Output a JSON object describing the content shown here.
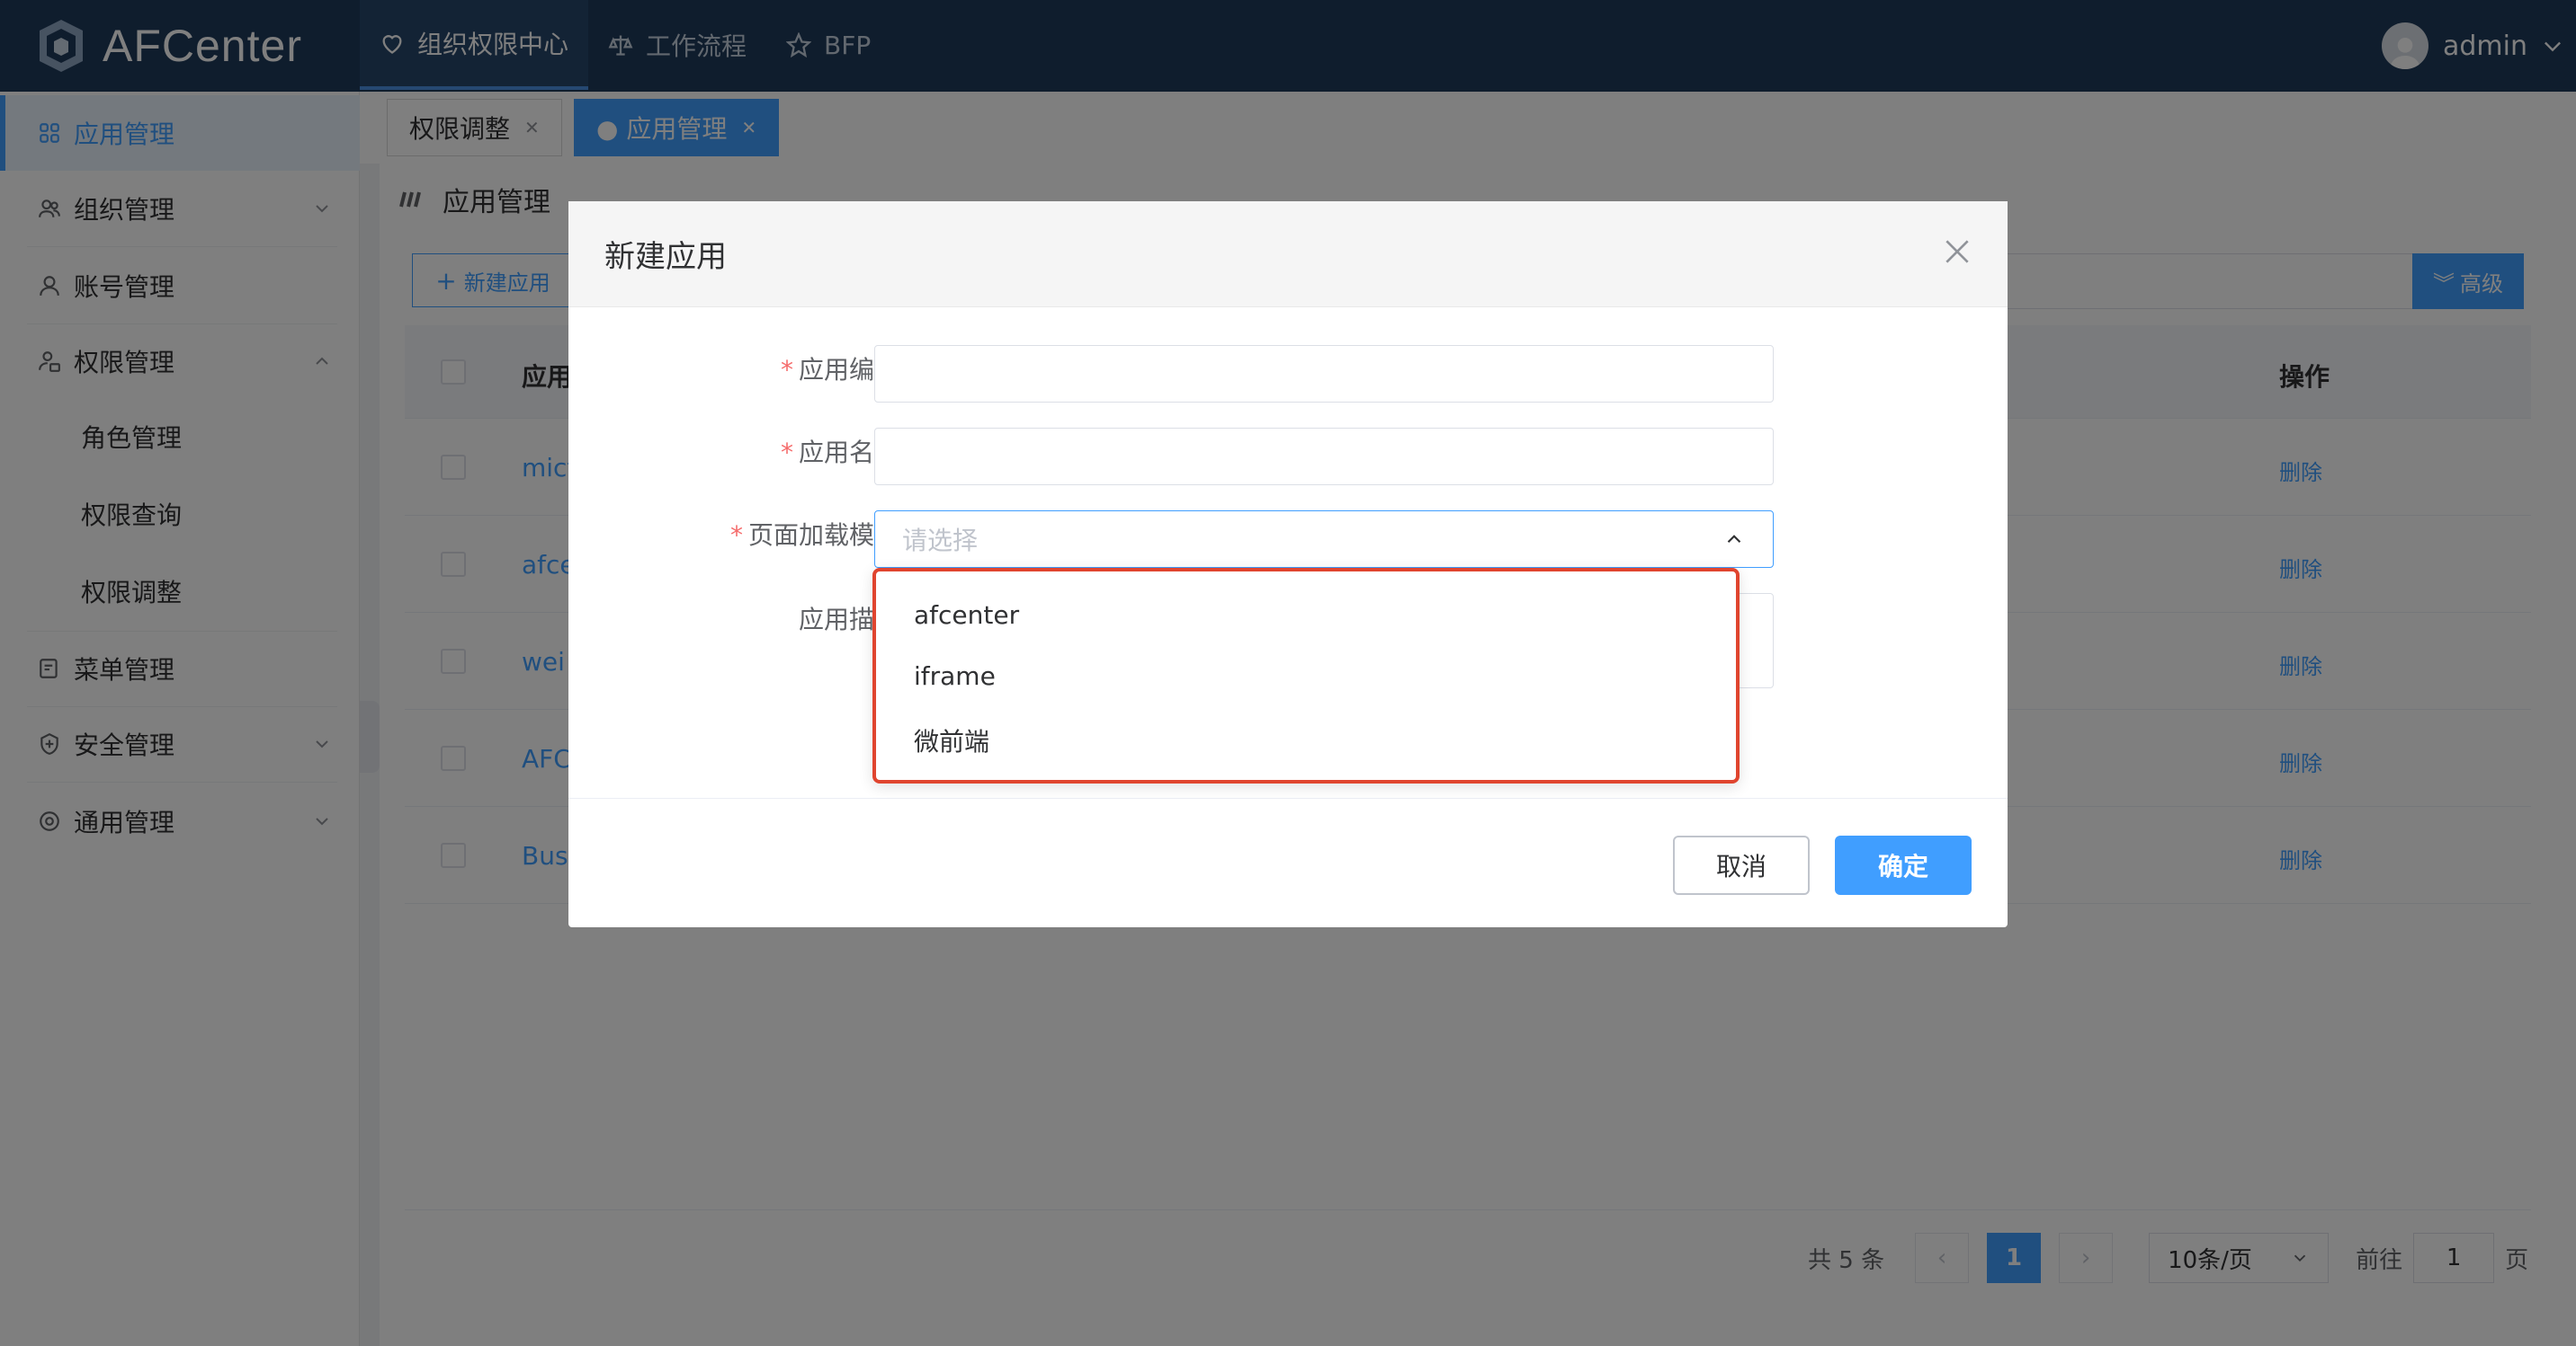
{
  "app": {
    "brand": "AFCenter"
  },
  "topnav": [
    {
      "label": "组织权限中心",
      "icon": "heart-icon",
      "active": true
    },
    {
      "label": "工作流程",
      "icon": "scale-icon",
      "active": false
    },
    {
      "label": "BFP",
      "icon": "star-icon",
      "active": false
    }
  ],
  "user": {
    "name": "admin"
  },
  "sidebar": {
    "items": [
      {
        "label": "应用管理",
        "icon": "grid-icon"
      },
      {
        "label": "组织管理",
        "icon": "users-icon"
      },
      {
        "label": "账号管理",
        "icon": "user-icon"
      },
      {
        "label": "权限管理",
        "icon": "user-lock-icon"
      },
      {
        "label": "菜单管理",
        "icon": "doc-icon"
      },
      {
        "label": "安全管理",
        "icon": "shield-icon"
      },
      {
        "label": "通用管理",
        "icon": "settings-icon"
      }
    ],
    "subitems": [
      "角色管理",
      "权限查询",
      "权限调整"
    ]
  },
  "tabs": [
    {
      "label": "权限调整",
      "active": false
    },
    {
      "label": "● 应用管理",
      "active": true
    }
  ],
  "page": {
    "title": "应用管理",
    "new_button": "新建应用",
    "adv_button": "高级"
  },
  "table": {
    "headers": {
      "name": "应用",
      "ops": "操作"
    },
    "rows": [
      {
        "name": "mict",
        "op": "删除"
      },
      {
        "name": "afce",
        "op": "删除"
      },
      {
        "name": "wei",
        "op": "删除"
      },
      {
        "name": "AFC",
        "op": "删除"
      },
      {
        "name": "Busi",
        "op": "删除"
      }
    ]
  },
  "pagination": {
    "total": "共 5 条",
    "current": "1",
    "page_size": "10条/页",
    "goto_prefix": "前往",
    "goto_value": "1",
    "goto_suffix": "页"
  },
  "dialog": {
    "title": "新建应用",
    "fields": {
      "code_label": "应用编号",
      "name_label": "应用名称",
      "mode_label": "页面加载模式",
      "mode_placeholder": "请选择",
      "desc_label": "应用描述"
    },
    "options": [
      "afcenter",
      "iframe",
      "微前端"
    ],
    "cancel": "取消",
    "ok": "确定"
  },
  "colors": {
    "header_bg": "#1f3a5a",
    "primary": "#409eff",
    "required": "#f56c6c",
    "highlight_border": "#e0452f"
  }
}
